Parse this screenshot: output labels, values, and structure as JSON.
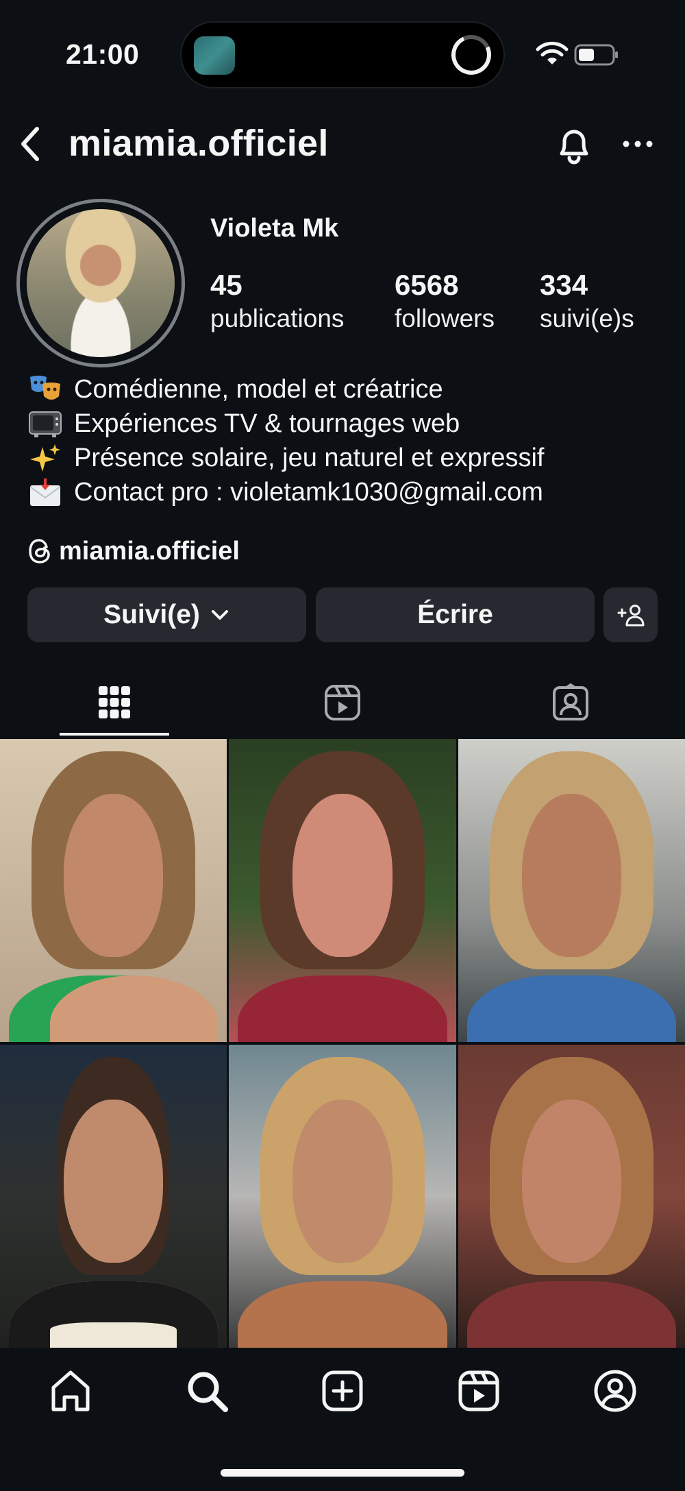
{
  "status_bar": {
    "time": "21:00"
  },
  "header": {
    "username": "miamia.officiel"
  },
  "profile": {
    "display_name": "Violeta Mk",
    "stats": {
      "posts_count": "45",
      "posts_label": "publications",
      "followers_count": "6568",
      "followers_label": "followers",
      "following_count": "334",
      "following_label": "suivi(e)s"
    },
    "bio": [
      {
        "emoji": "performing-arts",
        "text": "Comédienne, model et créatrice"
      },
      {
        "emoji": "television",
        "text": "Expériences TV & tournages web"
      },
      {
        "emoji": "sparkles",
        "text": "Présence solaire, jeu naturel et expressif"
      },
      {
        "emoji": "envelope-with-arrow",
        "text": "Contact pro : violetamk1030@gmail.com"
      }
    ],
    "threads_handle": "miamia.officiel"
  },
  "actions": {
    "following_label": "Suivi(e)",
    "message_label": "Écrire"
  },
  "tabs": [
    {
      "icon": "grid-icon",
      "active": true
    },
    {
      "icon": "reels-icon",
      "active": false
    },
    {
      "icon": "tagged-icon",
      "active": false
    }
  ],
  "grid_posts": [
    {
      "description": "woman with shoulder-length brown hair, green top"
    },
    {
      "description": "woman with brown hair, red top, plants behind"
    },
    {
      "description": "woman with blonde wavy hair, blue striped shirt, in car"
    },
    {
      "description": "woman with hair pulled back, black blazer"
    },
    {
      "description": "woman with curly blonde hair, tan suede jacket"
    },
    {
      "description": "woman with wavy hair, red vest, patterned tie"
    }
  ],
  "bottom_nav": [
    {
      "icon": "home-icon"
    },
    {
      "icon": "search-icon"
    },
    {
      "icon": "create-icon"
    },
    {
      "icon": "reels-icon"
    },
    {
      "icon": "profile-icon"
    }
  ],
  "colors": {
    "background": "#0c1014",
    "button": "#262a30",
    "text": "#f5f5f5"
  }
}
